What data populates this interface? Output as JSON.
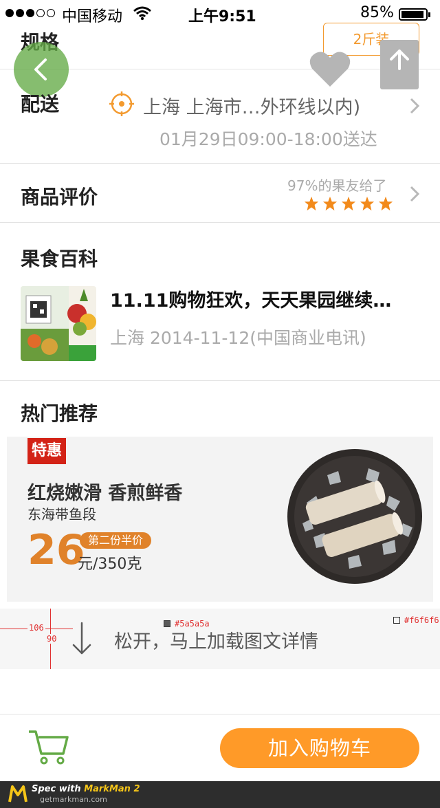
{
  "status_bar": {
    "carrier": "中国移动",
    "time": "上午9:51",
    "battery": "85%",
    "battery_level": 0.85,
    "signal_bars_filled": 3,
    "signal_bars_total": 5
  },
  "spec": {
    "label": "规格",
    "selected": "2斤装"
  },
  "delivery": {
    "label": "配送",
    "address": "上海 上海市…外环线以内)",
    "time": "01月29日09:00-18:00送达"
  },
  "reviews": {
    "label": "商品评价",
    "summary": "97%的果友给了",
    "stars": 5
  },
  "encyclopedia": {
    "label": "果食百科",
    "article": {
      "title": "11.11购物狂欢，天天果园继续…",
      "meta": "上海 2014-11-12(中国商业电讯)"
    }
  },
  "hot": {
    "label": "热门推荐",
    "banner": {
      "badge": "特惠",
      "headline": "红烧嫩滑 香煎鲜香",
      "product": "东海带鱼段",
      "price": "26",
      "promo": "第二份半价",
      "unit": "元/350克"
    }
  },
  "pull": {
    "text": "松开，马上加载图文详情"
  },
  "annotations": {
    "width": "106",
    "height": "90",
    "text_color": "#5a5a5a",
    "bg_color": "#f6f6f6"
  },
  "bottom_bar": {
    "add_to_cart": "加入购物车"
  },
  "watermark": {
    "prefix": "Spec with",
    "brand": "MarkMan 2",
    "url": "getmarkman.com"
  },
  "colors": {
    "accent": "#f39a2f",
    "cart_button": "#ff9a28",
    "back_button": "#64aa46",
    "star": "#f28a1b",
    "price": "#e0822a",
    "badge": "#d32216"
  }
}
